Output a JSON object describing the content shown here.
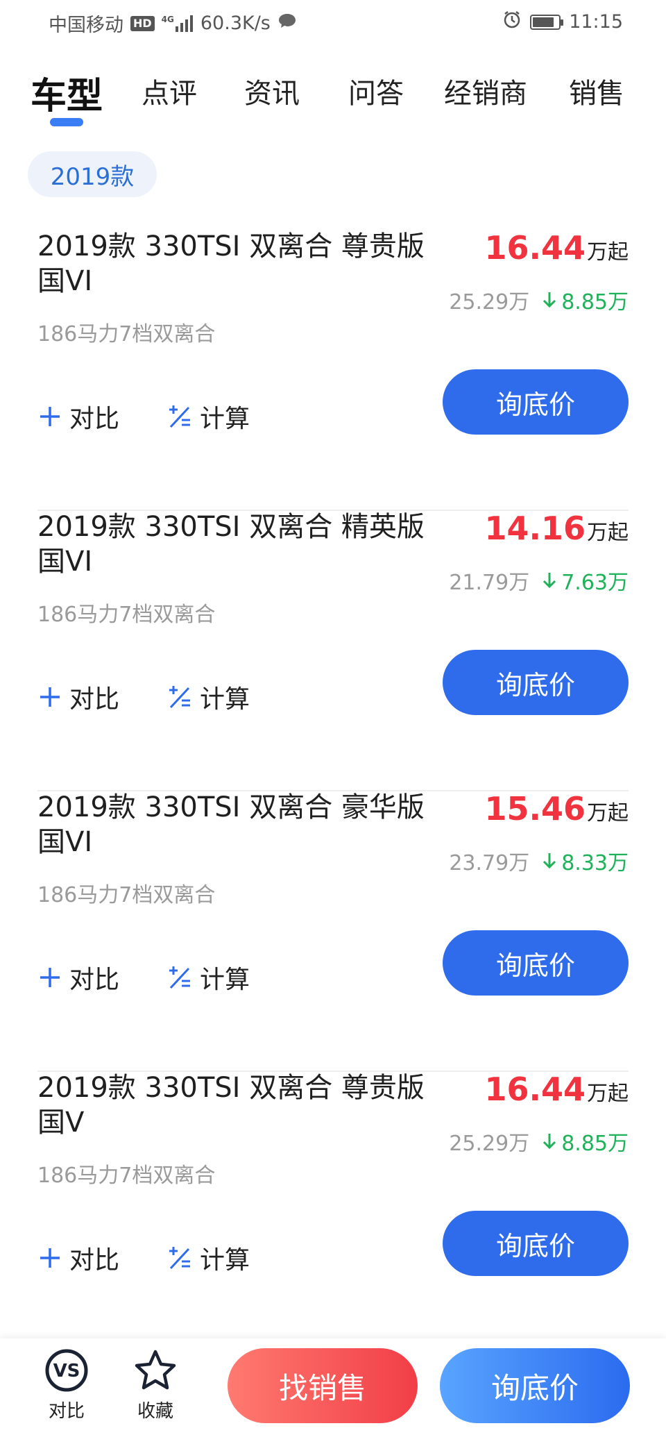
{
  "status_bar": {
    "carrier": "中国移动",
    "hd": "HD",
    "network": "4G",
    "speed": "60.3K/s",
    "time": "11:15",
    "battery_level": 0.85,
    "icons": [
      "signal-icon",
      "chat-bubble-icon",
      "alarm-icon",
      "battery-icon"
    ]
  },
  "tabs": [
    {
      "label": "车型",
      "active": true
    },
    {
      "label": "点评",
      "active": false
    },
    {
      "label": "资讯",
      "active": false
    },
    {
      "label": "问答",
      "active": false
    },
    {
      "label": "经销商",
      "active": false
    },
    {
      "label": "销售",
      "active": false
    }
  ],
  "year_filter": "2019款",
  "cards": [
    {
      "title": "2019款 330TSI 双离合 尊贵版 国VI",
      "spec": "186马力7档双离合",
      "price": "16.44",
      "price_suffix": "万起",
      "original_price": "25.29万",
      "drop": "8.85万",
      "compare_label": "对比",
      "calc_label": "计算",
      "inquiry_label": "询底价"
    },
    {
      "title": "2019款 330TSI 双离合 精英版 国VI",
      "spec": "186马力7档双离合",
      "price": "14.16",
      "price_suffix": "万起",
      "original_price": "21.79万",
      "drop": "7.63万",
      "compare_label": "对比",
      "calc_label": "计算",
      "inquiry_label": "询底价"
    },
    {
      "title": "2019款 330TSI 双离合 豪华版 国VI",
      "spec": "186马力7档双离合",
      "price": "15.46",
      "price_suffix": "万起",
      "original_price": "23.79万",
      "drop": "8.33万",
      "compare_label": "对比",
      "calc_label": "计算",
      "inquiry_label": "询底价"
    },
    {
      "title": "2019款 330TSI 双离合 尊贵版 国V",
      "spec": "186马力7档双离合",
      "price": "16.44",
      "price_suffix": "万起",
      "original_price": "25.29万",
      "drop": "8.85万",
      "compare_label": "对比",
      "calc_label": "计算",
      "inquiry_label": "询底价"
    }
  ],
  "bottom_bar": {
    "vs_icon_text": "VS",
    "compare_label": "对比",
    "favorite_label": "收藏",
    "find_sales_label": "找销售",
    "inquiry_label": "询底价"
  },
  "colors": {
    "accent_blue": "#2f6cec",
    "price_red": "#f0333e",
    "drop_green": "#1fb25a",
    "chip_bg": "#eef3fb"
  }
}
